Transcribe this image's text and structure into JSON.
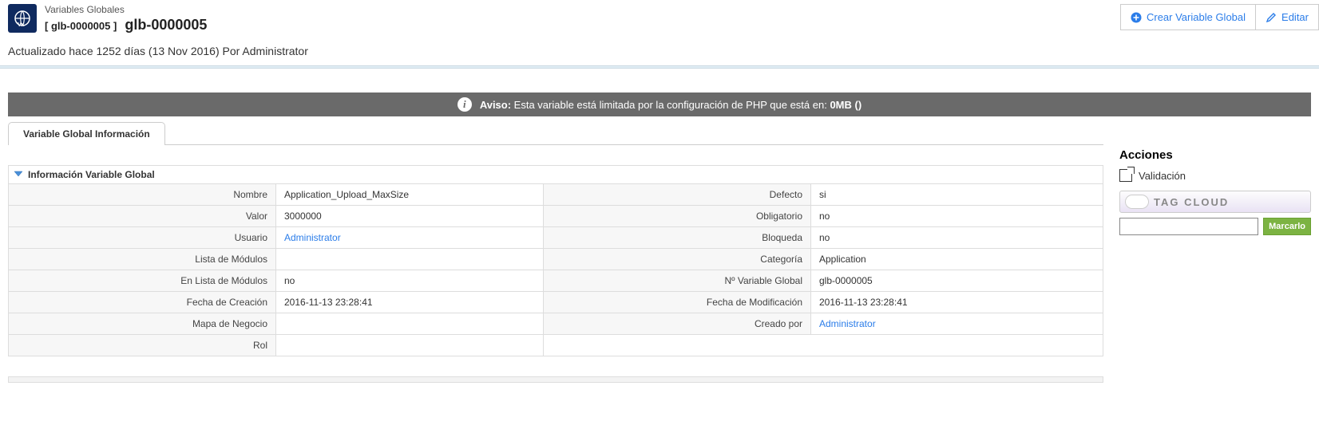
{
  "header": {
    "breadcrumb": "Variables Globales",
    "code_bracket": "[ glb-0000005 ]",
    "title": "glb-0000005",
    "btn_create": "Crear Variable Global",
    "btn_edit": "Editar"
  },
  "updated_line": "Actualizado hace 1252 días (13 Nov 2016) Por Administrator",
  "notice": {
    "prefix": "Aviso:",
    "text": " Esta variable está limitada por la configuración de PHP que está en: ",
    "bold_suffix": "0MB ()"
  },
  "tab_label": "Variable Global Información",
  "panel_title": "Información Variable Global",
  "fields": {
    "nombre_label": "Nombre",
    "nombre_value": "Application_Upload_MaxSize",
    "defecto_label": "Defecto",
    "defecto_value": "si",
    "valor_label": "Valor",
    "valor_value": "3000000",
    "obligatorio_label": "Obligatorio",
    "obligatorio_value": "no",
    "usuario_label": "Usuario",
    "usuario_value": "Administrator",
    "bloqueda_label": "Bloqueda",
    "bloqueda_value": "no",
    "lista_modulos_label": "Lista de Módulos",
    "lista_modulos_value": "",
    "categoria_label": "Categoría",
    "categoria_value": "Application",
    "en_lista_modulos_label": "En Lista de Módulos",
    "en_lista_modulos_value": "no",
    "num_var_global_label": "Nº Variable Global",
    "num_var_global_value": "glb-0000005",
    "fecha_creacion_label": "Fecha de Creación",
    "fecha_creacion_value": "2016-11-13 23:28:41",
    "fecha_modificacion_label": "Fecha de Modificación",
    "fecha_modificacion_value": "2016-11-13 23:28:41",
    "mapa_negocio_label": "Mapa de Negocio",
    "mapa_negocio_value": "",
    "creado_por_label": "Creado por",
    "creado_por_value": "Administrator",
    "rol_label": "Rol",
    "rol_value": ""
  },
  "sidebar": {
    "acciones_title": "Acciones",
    "validacion_label": "Validación",
    "tagcloud_label": "TAG CLOUD",
    "tag_button": "Marcarlo"
  }
}
